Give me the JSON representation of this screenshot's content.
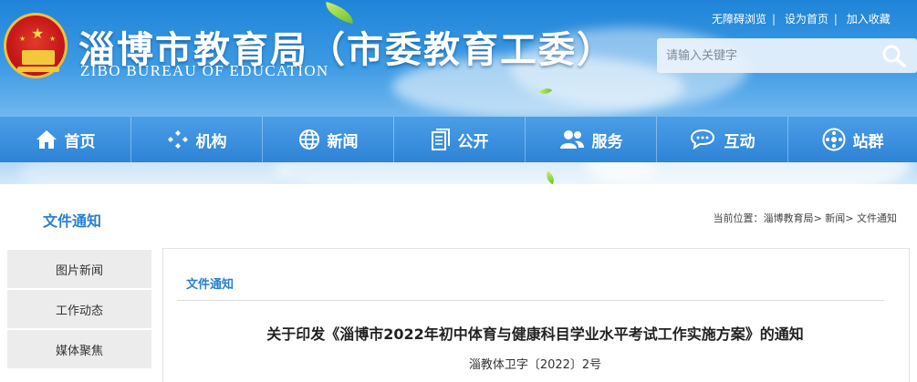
{
  "header": {
    "title_cn": "淄博市教育局（市委教育工委）",
    "title_en": "ZIBO BUREAU OF EDUCATION",
    "links": [
      "无障碍浏览",
      "设为首页",
      "加入收藏"
    ],
    "link_separator": "|",
    "search_placeholder": "请输入关键字"
  },
  "nav": {
    "items": [
      {
        "label": "首页",
        "icon": "home-icon"
      },
      {
        "label": "机构",
        "icon": "org-icon"
      },
      {
        "label": "新闻",
        "icon": "globe-icon"
      },
      {
        "label": "公开",
        "icon": "document-icon"
      },
      {
        "label": "服务",
        "icon": "people-icon"
      },
      {
        "label": "互动",
        "icon": "chat-icon"
      },
      {
        "label": "站群",
        "icon": "network-icon"
      }
    ]
  },
  "section": {
    "title": "文件通知",
    "breadcrumb_prefix": "当前位置：",
    "breadcrumb": [
      "淄博教育局",
      "新闻",
      "文件通知"
    ],
    "breadcrumb_sep": ">"
  },
  "sidebar": {
    "items": [
      {
        "label": "图片新闻"
      },
      {
        "label": "工作动态"
      },
      {
        "label": "媒体聚焦"
      }
    ]
  },
  "content": {
    "label": "文件通知",
    "title": "关于印发《淄博市2022年初中体育与健康科目学业水平考试工作实施方案》的通知",
    "doc_number": "淄教体卫字〔2022〕2号"
  },
  "colors": {
    "accent": "#2a7fd2",
    "nav_bg": "#2e83d6"
  }
}
